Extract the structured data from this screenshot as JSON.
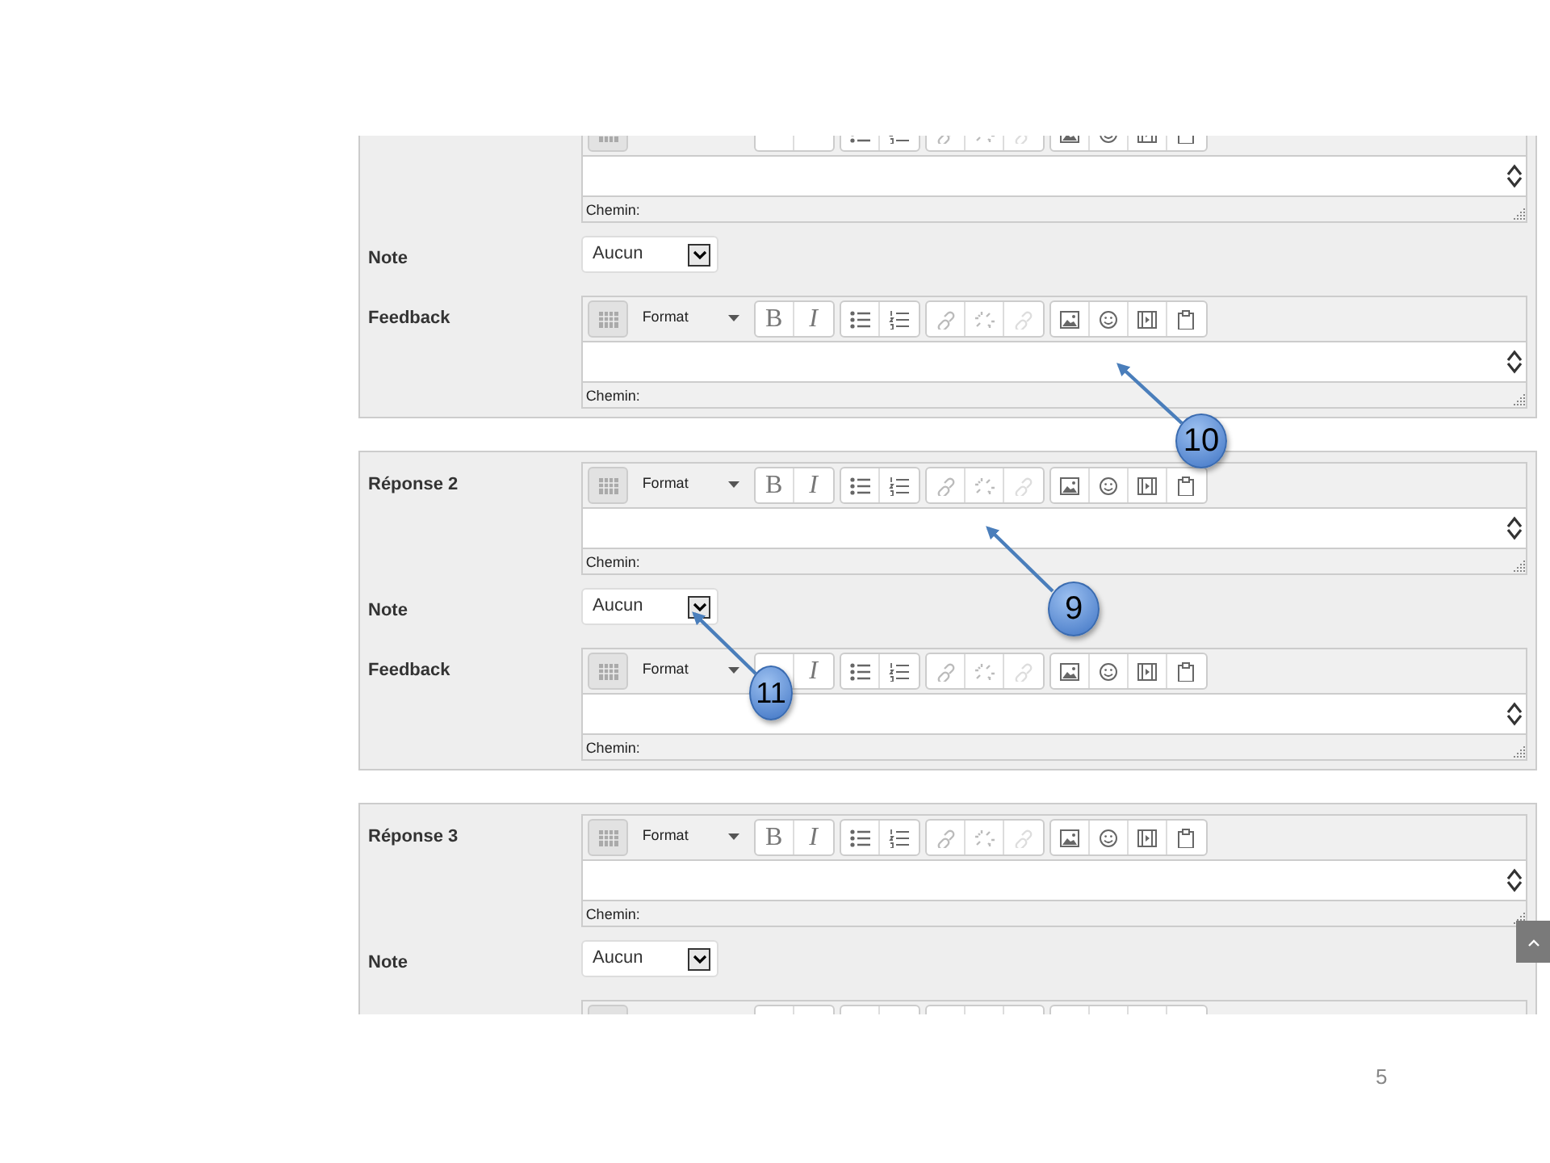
{
  "panels": [
    {
      "fields": [
        {
          "kind": "editor",
          "links_disabled": true,
          "path": "Chemin:"
        },
        {
          "kind": "select",
          "label": "Note",
          "value": "Aucun"
        },
        {
          "kind": "editor",
          "label": "Feedback",
          "format": "Format",
          "bold": "B",
          "italic": "I",
          "links_disabled": true,
          "path": "Chemin:"
        }
      ]
    },
    {
      "fields": [
        {
          "kind": "editor",
          "label": "Réponse 2",
          "format": "Format",
          "bold": "B",
          "italic": "I",
          "links_disabled": true,
          "path": "Chemin:"
        },
        {
          "kind": "select",
          "label": "Note",
          "value": "Aucun"
        },
        {
          "kind": "editor",
          "label": "Feedback",
          "format": "Format",
          "italic": "I",
          "links_disabled": true,
          "path": "Chemin:"
        }
      ]
    },
    {
      "fields": [
        {
          "kind": "editor",
          "label": "Réponse 3",
          "format": "Format",
          "bold": "B",
          "italic": "I",
          "links_disabled": true,
          "path": "Chemin:"
        },
        {
          "kind": "select",
          "label": "Note",
          "value": "Aucun"
        },
        {
          "kind": "editor"
        }
      ]
    }
  ],
  "callouts": [
    {
      "number": "10"
    },
    {
      "number": "9"
    },
    {
      "number": "11"
    }
  ],
  "slide_number": "5"
}
